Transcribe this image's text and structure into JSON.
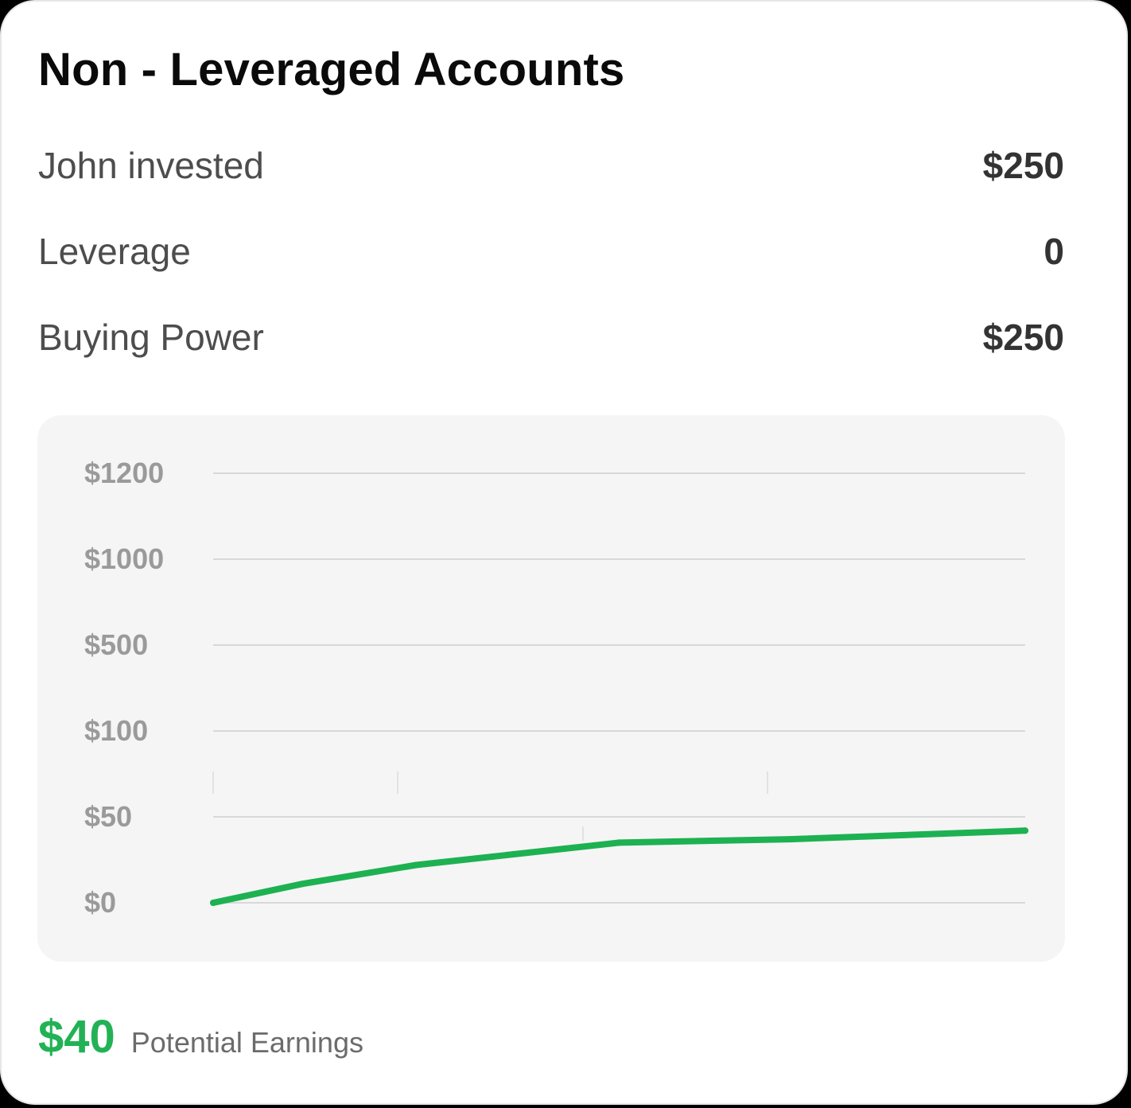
{
  "card": {
    "title": "Non - Leveraged Accounts"
  },
  "stats": [
    {
      "label": "John invested",
      "value": "$250"
    },
    {
      "label": "Leverage",
      "value": "0"
    },
    {
      "label": "Buying Power",
      "value": "$250"
    }
  ],
  "footer": {
    "amount": "$40",
    "caption": "Potential Earnings"
  },
  "colors": {
    "accent": "#22b255",
    "line": "#1db152",
    "grid": "#d8d8d8",
    "tick_text": "#9a9a9a",
    "panel_bg": "#f5f5f5"
  },
  "chart_data": {
    "type": "line",
    "title": "",
    "xlabel": "",
    "ylabel": "",
    "y_ticks": [
      "$1200",
      "$1000",
      "$500",
      "$100",
      "$50",
      "$0"
    ],
    "y_tick_values": [
      1200,
      1000,
      500,
      100,
      50,
      0
    ],
    "grid": true,
    "series": [
      {
        "x": [
          0,
          0.11,
          0.25,
          0.5,
          0.71,
          1.0
        ],
        "y": [
          0,
          11,
          22,
          35,
          37,
          42
        ]
      }
    ]
  }
}
